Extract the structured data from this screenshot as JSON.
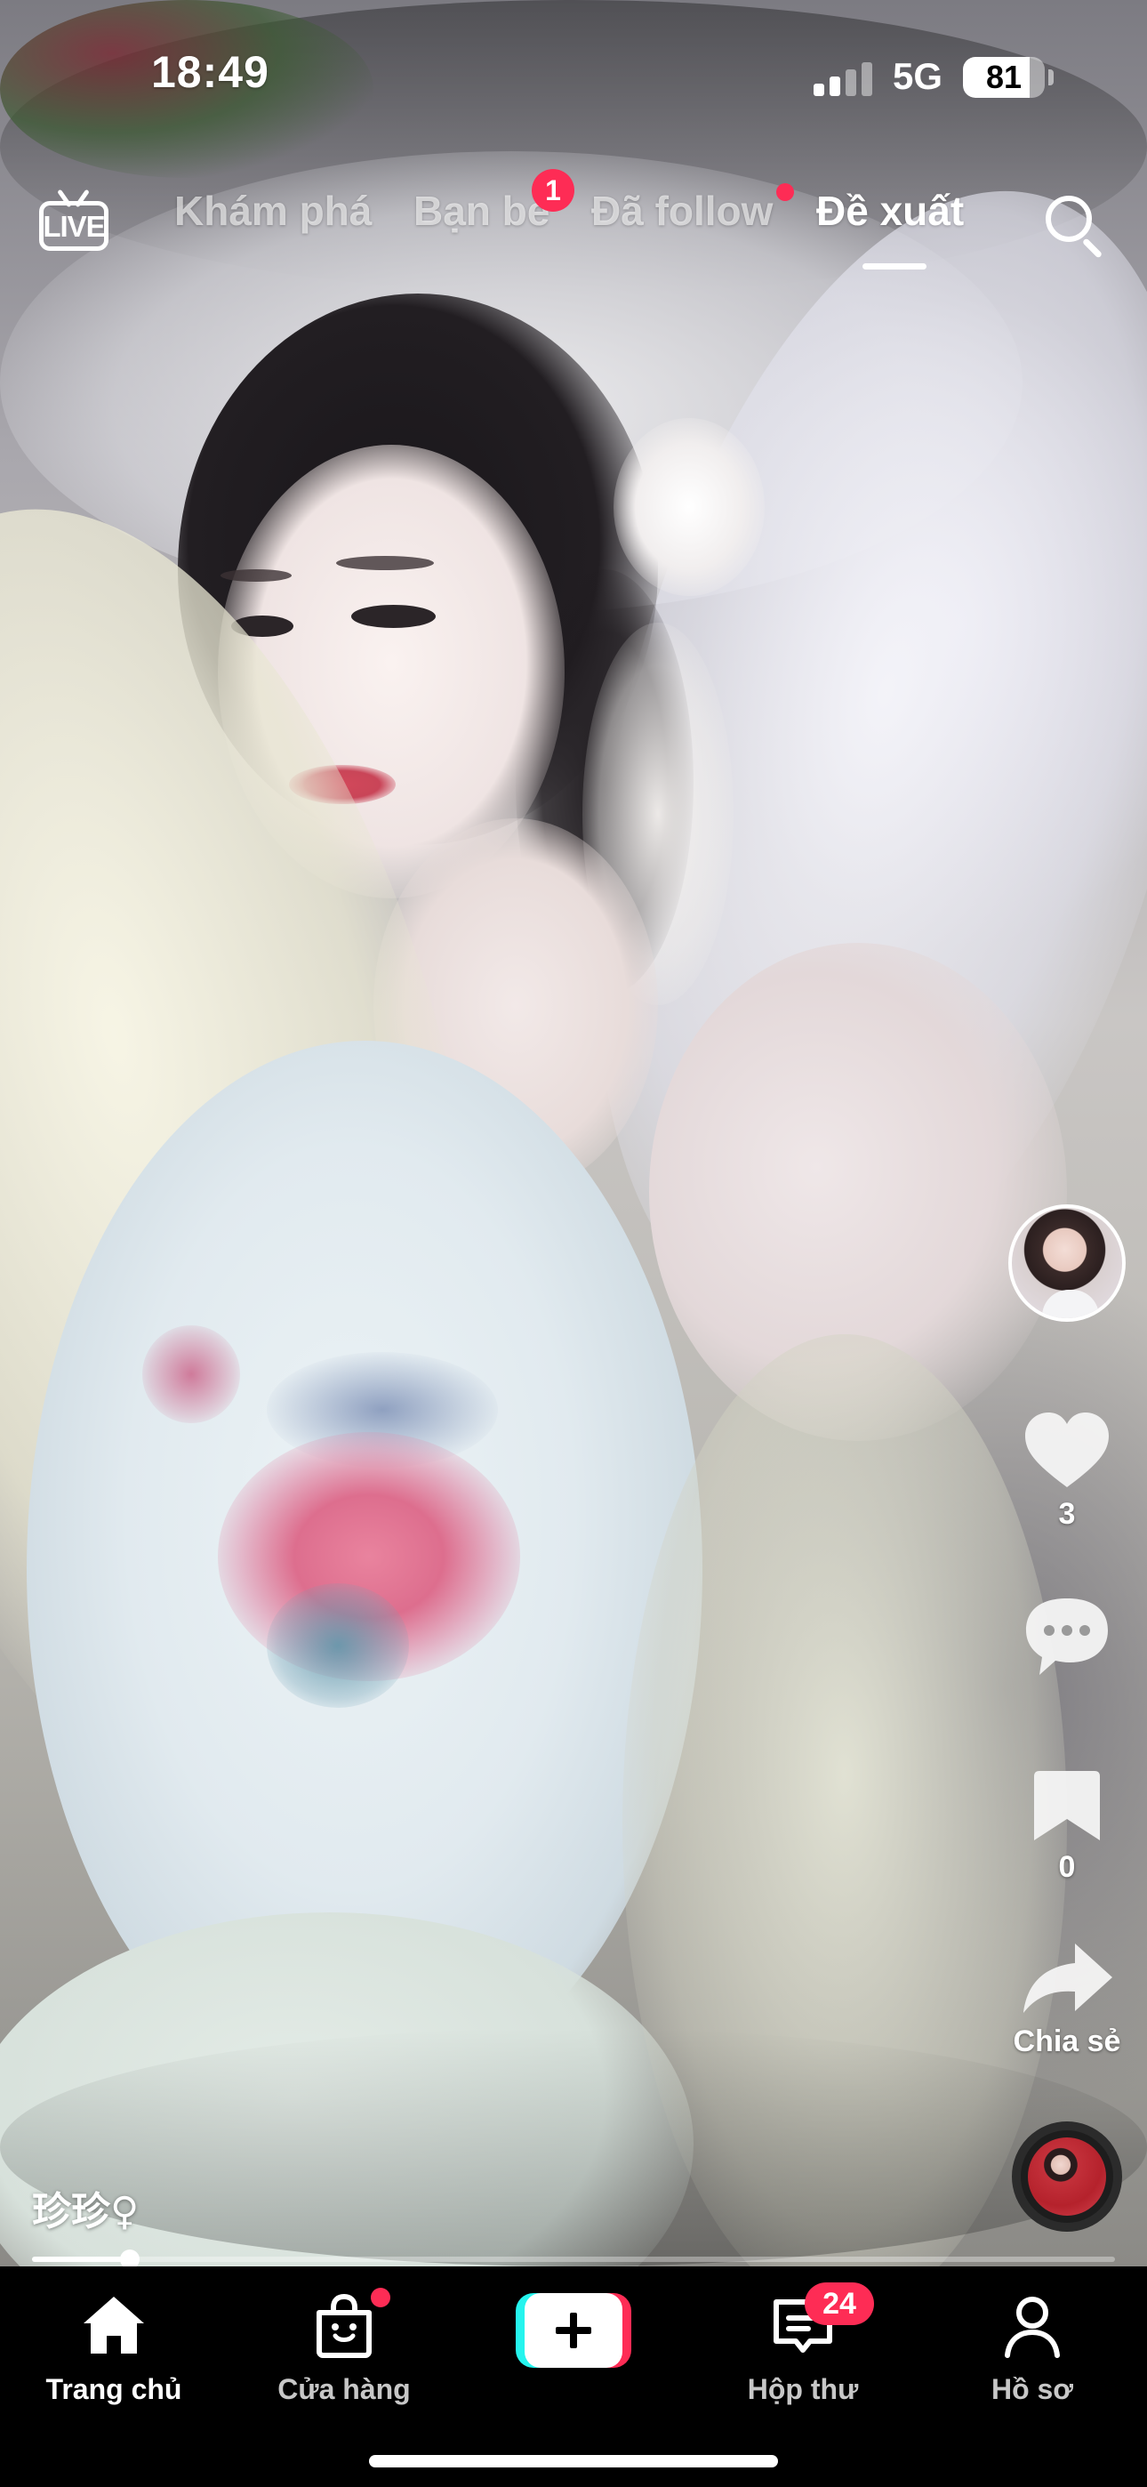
{
  "status_bar": {
    "time": "18:49",
    "network": "5G",
    "battery_level": "81",
    "battery_fraction": 0.81,
    "signal_bars_active": 2,
    "signal_bars_total": 4
  },
  "top_nav": {
    "live_label": "LIVE",
    "tabs": [
      {
        "label": "Khám phá",
        "active": false
      },
      {
        "label": "Bạn bè",
        "active": false,
        "badge": "1"
      },
      {
        "label": "Đã follow",
        "active": false,
        "dot": true
      },
      {
        "label": "Đề xuất",
        "active": true
      }
    ],
    "search_icon": "search-icon"
  },
  "actions": {
    "like_count": "3",
    "save_count": "0",
    "share_label": "Chia sẻ",
    "icons": [
      "heart-icon",
      "comment-icon",
      "bookmark-icon",
      "share-arrow-icon",
      "music-disc-icon"
    ]
  },
  "video": {
    "username": "珍珍♀",
    "progress_fraction": 0.09
  },
  "bottom_nav": {
    "items": [
      {
        "label": "Trang chủ",
        "icon": "home-icon",
        "active": true
      },
      {
        "label": "Cửa hàng",
        "icon": "shopping-bag-icon",
        "dot": true
      },
      {
        "label": "",
        "icon": "plus-icon"
      },
      {
        "label": "Hộp thư",
        "icon": "inbox-icon",
        "badge": "24"
      },
      {
        "label": "Hồ sơ",
        "icon": "profile-icon"
      }
    ]
  },
  "colors": {
    "accent": "#fe2c55",
    "cyan": "#25f4ee",
    "bar_background": "#000000"
  }
}
